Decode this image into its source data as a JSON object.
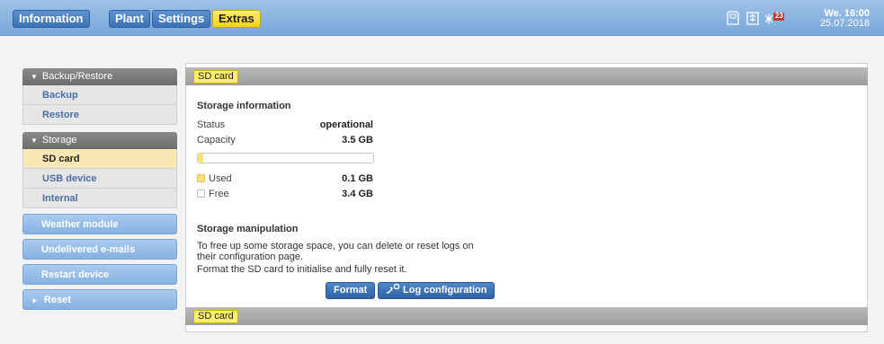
{
  "nav": {
    "tabs": [
      {
        "label": "Information"
      },
      {
        "label": "Plant"
      },
      {
        "label": "Settings"
      },
      {
        "label": "Extras"
      }
    ],
    "icons": [
      "sd-card-icon",
      "usb-device-icon",
      "notification-icon"
    ],
    "notification_count": "23",
    "clock": {
      "time": "We. 16:00",
      "date": "25.07.2018"
    }
  },
  "sidebar": {
    "backup_group": {
      "title": "Backup/Restore",
      "items": [
        {
          "label": "Backup"
        },
        {
          "label": "Restore"
        }
      ]
    },
    "storage_group": {
      "title": "Storage",
      "items": [
        {
          "label": "SD card"
        },
        {
          "label": "USB device"
        },
        {
          "label": "Internal"
        }
      ]
    },
    "buttons": [
      {
        "label": "Weather module"
      },
      {
        "label": "Undelivered e-mails"
      },
      {
        "label": "Restart device"
      },
      {
        "label": "Reset"
      }
    ]
  },
  "panel": {
    "crumb": "SD card",
    "storage_info_title": "Storage information",
    "status_label": "Status",
    "status_value": "operational",
    "capacity_label": "Capacity",
    "capacity_value": "3.5 GB",
    "used_fraction": 0.03,
    "used_label": "Used",
    "used_value": "0.1 GB",
    "free_label": "Free",
    "free_value": "3.4 GB",
    "manipulation_title": "Storage manipulation",
    "manipulation_text": "To free up some storage space, you can delete or reset logs on their configuration page.",
    "format_text": "Format the SD card to initialise and fully reset it.",
    "format_button": "Format",
    "log_config_button": "Log configuration",
    "footer_crumb": "SD card"
  },
  "colors": {
    "accent_yellow": "#ffe37a",
    "brand_blue": "#3d72b4"
  }
}
